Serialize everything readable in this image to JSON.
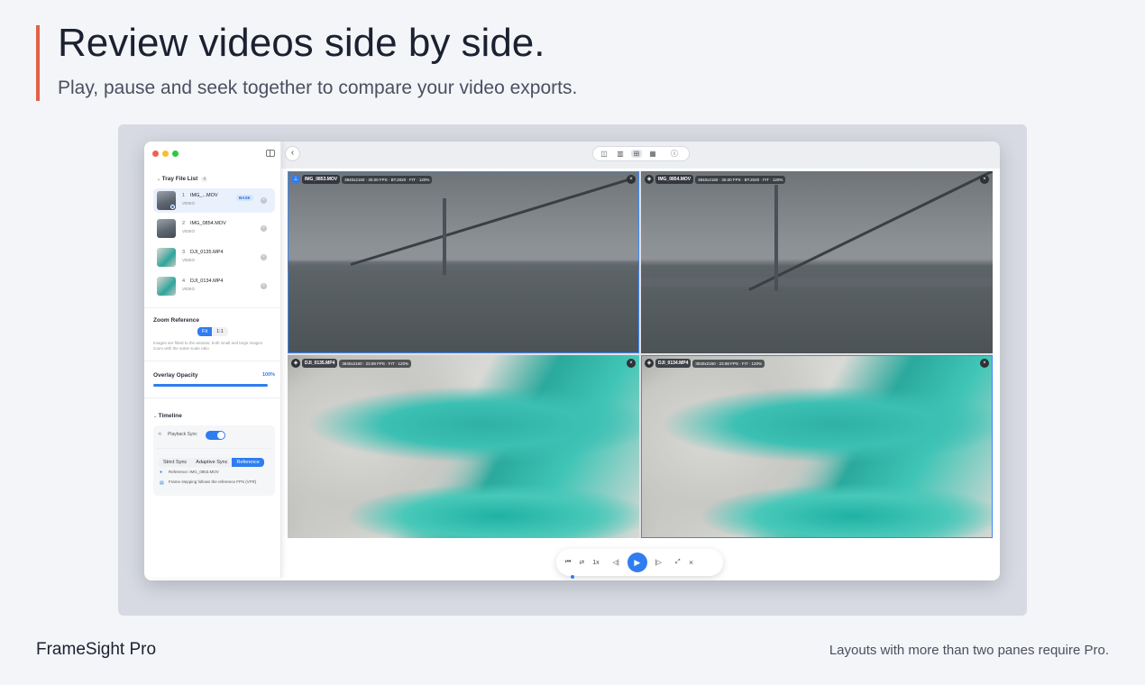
{
  "hero": {
    "title": "Review videos side by side.",
    "subtitle": "Play, pause and seek together to compare your video exports."
  },
  "colors": {
    "accent_bar": "#e4604a",
    "primary": "#2f7df0",
    "traffic_red": "#f25f58",
    "traffic_yellow": "#fbbd2e",
    "traffic_green": "#2bc840"
  },
  "sidebar": {
    "tray_title": "Tray File List",
    "tray_count": "4",
    "files": [
      {
        "index": "1",
        "name": "IMG_...MOV",
        "sub": "VIDEO",
        "badge": "BASE",
        "selected": true
      },
      {
        "index": "2",
        "name": "IMG_0854.MOV",
        "sub": "VIDEO",
        "badge": "",
        "selected": false
      },
      {
        "index": "3",
        "name": "DJI_0135.MP4",
        "sub": "VIDEO",
        "badge": "",
        "selected": false
      },
      {
        "index": "4",
        "name": "DJI_0134.MP4",
        "sub": "VIDEO",
        "badge": "",
        "selected": false
      }
    ],
    "zoom": {
      "title": "Zoom Reference",
      "options": [
        "Fit",
        "1:1"
      ],
      "selected": "Fit",
      "hint": "Images are fitted to the window; both small and large images zoom with the same scale ratio"
    },
    "opacity": {
      "title": "Overlay Opacity",
      "value": "100%",
      "level": 1.0
    },
    "timeline": {
      "title": "Timeline",
      "playback_sync_label": "Playback Sync",
      "playback_sync_on": true,
      "modes": [
        "Strict Sync",
        "Adaptive Sync",
        "Reference"
      ],
      "selected_mode": "Reference",
      "reference_label": "Reference: IMG_0853.MOV",
      "stepping_label": "Frame stepping follows the reference FPS (VFR)"
    }
  },
  "panes": [
    {
      "name": "IMG_0853.MOV",
      "meta": "3840x2160 · 30.00 FPS · BT.2020 · FIT · 120%",
      "icon": "pin-icon",
      "selected": true
    },
    {
      "name": "IMG_0854.MOV",
      "meta": "3840x2160 · 30.00 FPS · BT.2020 · FIT · 120%",
      "icon": "layers-icon",
      "selected": false
    },
    {
      "name": "DJI_0135.MP4",
      "meta": "3840x2160 · 23.98 FPS · FIT · 120%",
      "icon": "layers-icon",
      "selected": false
    },
    {
      "name": "DJI_0134.MP4",
      "meta": "3840x2160 · 23.98 FPS · FIT · 120%",
      "icon": "layers-icon",
      "selected": true
    }
  ],
  "controls": {
    "speed": "1x"
  },
  "footer": {
    "brand": "FrameSight Pro",
    "note": "Layouts with more than two panes require Pro."
  }
}
